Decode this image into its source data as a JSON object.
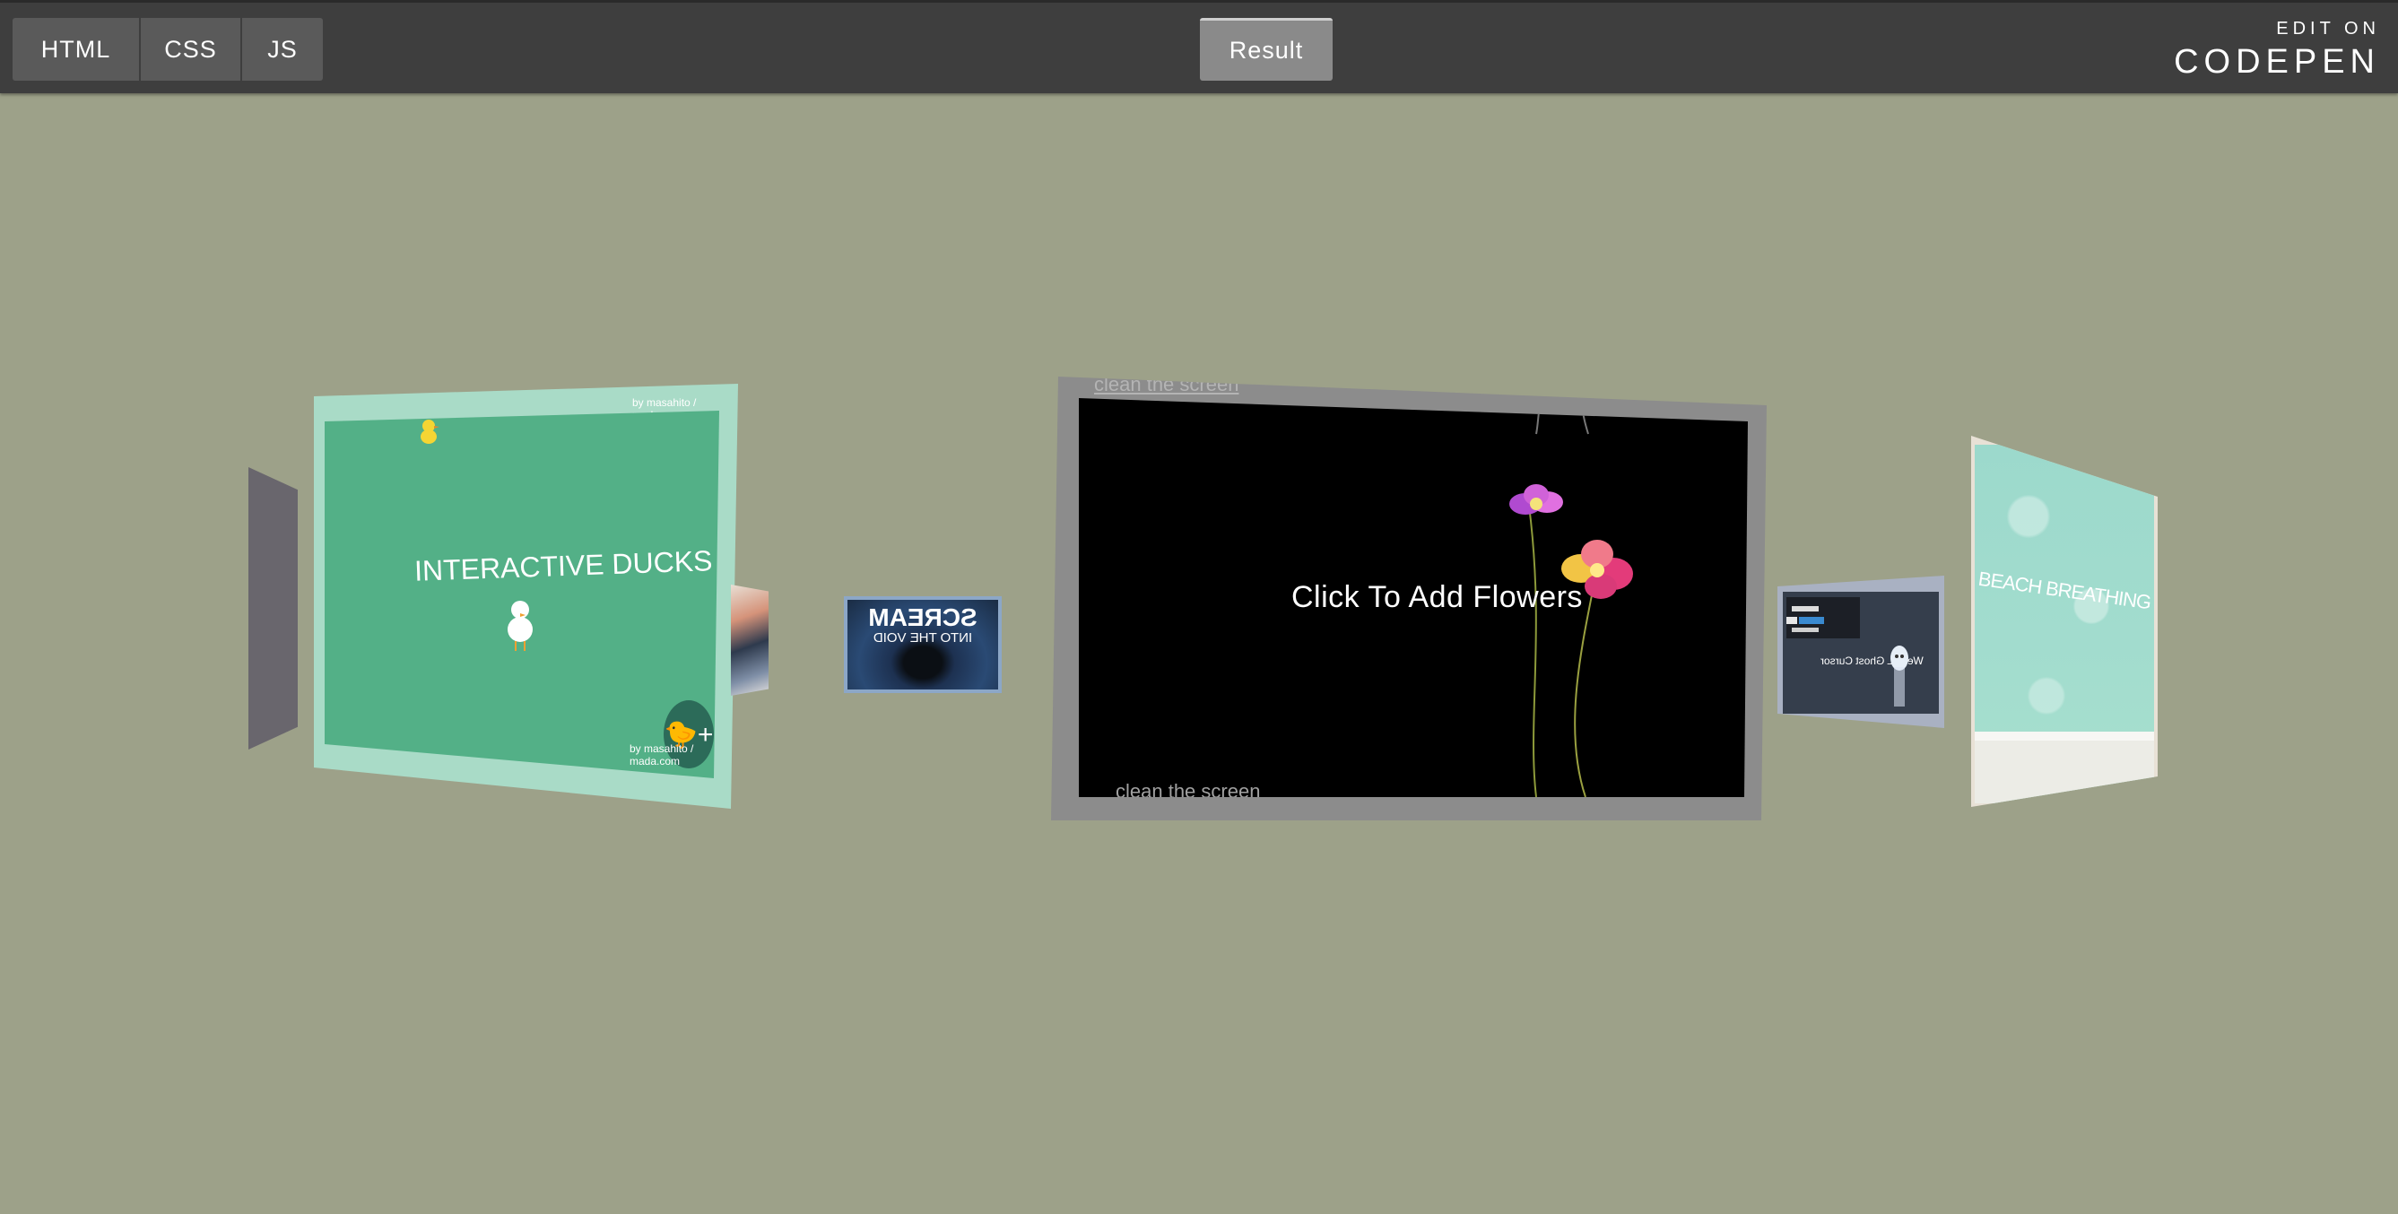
{
  "tabs": {
    "html": "HTML",
    "css": "CSS",
    "js": "JS",
    "result": "Result"
  },
  "codepen": {
    "edit": "EDIT ON",
    "brand": "CODEPEN"
  },
  "cards": {
    "ducks": {
      "title": "INTERACTIVE DUCKS",
      "credit": "by masahito / mada.com"
    },
    "scream": {
      "title": "SCREAM",
      "subtitle": "INTO THE VOID"
    },
    "flowers": {
      "title": "Click To Add Flowers",
      "clean_link": "clean the screen"
    },
    "ghost": {
      "label": "WebGL Ghost Cursor"
    },
    "beach": {
      "title": "BEACH BREATHING"
    }
  },
  "colors": {
    "background": "#9da189",
    "toolbar": "#3e3e3e",
    "duck_green": "#53b087"
  }
}
